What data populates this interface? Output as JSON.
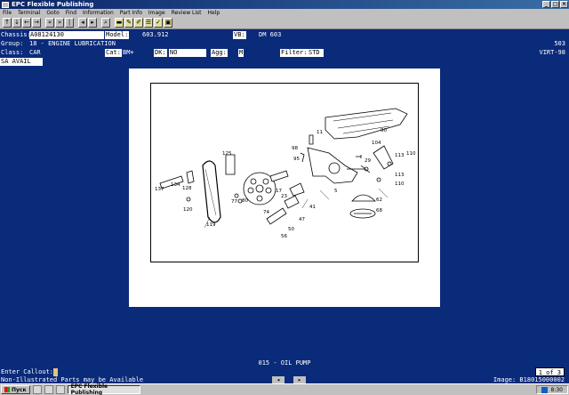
{
  "window": {
    "title": "EPC Flexible Publishing",
    "controls": [
      "_",
      "□",
      "×"
    ]
  },
  "menu": [
    "File",
    "Terminal",
    "Goto",
    "Find",
    "Information",
    "Part Info",
    "Image",
    "Review List",
    "Help"
  ],
  "header": {
    "chassis_label": "Chassis:",
    "chassis_value": "A08124130",
    "model_label": "Model:",
    "model_value": "603.912",
    "vb_label": "VB:",
    "vb_value": "DM 603",
    "group_label": "Group:",
    "group_value": "18 - ENGINE LUBRICATION",
    "group_right": "503",
    "class_label": "Class:",
    "class_value": "CAR",
    "cat_label": "Cat:",
    "cat_value": "BM+",
    "dk_label": "DK:",
    "dk_value": "NO",
    "agg_label": "Agg:",
    "agg_value": "M",
    "filter_label": "Filter:",
    "filter_value": "STD",
    "virt_value": "VIRT-98",
    "sa_value": "SA AVAIL"
  },
  "diagram": {
    "callouts": [
      "90",
      "98",
      "11",
      "95",
      "104",
      "113",
      "110",
      "29",
      "125",
      "137",
      "134",
      "128",
      "120",
      "119",
      "77",
      "80",
      "17",
      "23",
      "74",
      "41",
      "47",
      "50",
      "56",
      "5",
      "62",
      "68",
      "113",
      "110"
    ]
  },
  "caption": "015 - OIL PUMP",
  "callout_prompt": "Enter Callout:",
  "pager": "1 of 3",
  "note": "Non-Illustrated Parts may be Available",
  "image_ref": "Image: B18015000002",
  "taskbar": {
    "start": "Пуск",
    "task": "EPC Flexible Publishing",
    "clock": "8:30"
  }
}
